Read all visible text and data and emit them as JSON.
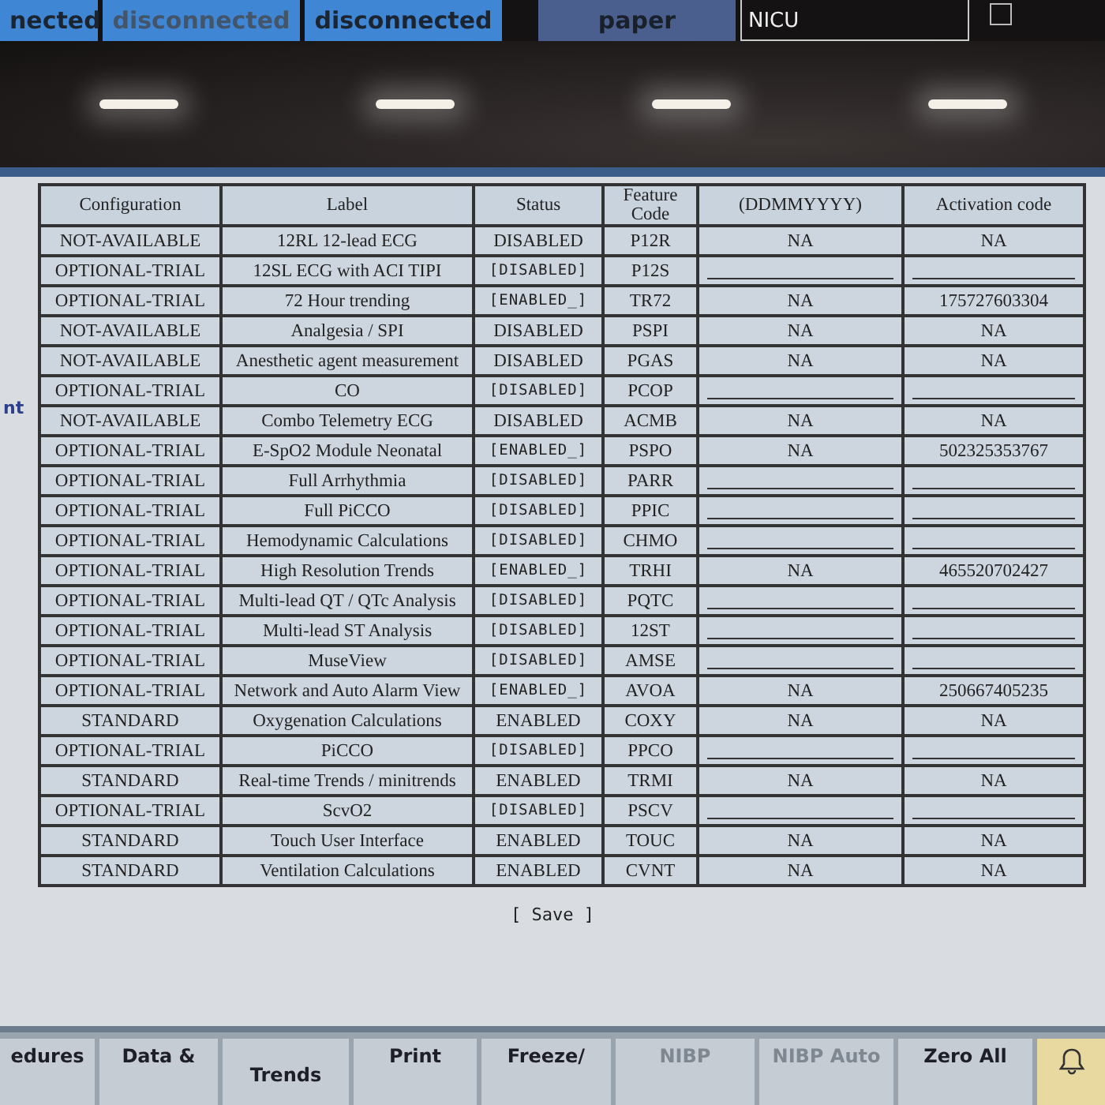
{
  "top_bar": {
    "buttons": [
      {
        "label": "nected",
        "dim": false
      },
      {
        "label": "disconnected",
        "dim": true
      },
      {
        "label": "disconnected",
        "dim": false
      }
    ],
    "paper_button": "paper",
    "location": "NICU",
    "checkbox": {
      "checked": false
    }
  },
  "side_text": "nt",
  "table": {
    "columns": [
      "Configuration",
      "Label",
      "Status",
      "Feature Code",
      "(DDMMYYYY)",
      "Activation code"
    ],
    "rows": [
      {
        "configuration": "NOT-AVAILABLE",
        "label": "12RL 12-lead ECG",
        "status": "DISABLED",
        "editable": false,
        "code": "P12R",
        "expiration": "NA",
        "activation": "NA"
      },
      {
        "configuration": "OPTIONAL-TRIAL",
        "label": "12SL ECG with ACI TIPI",
        "status": "[DISABLED]",
        "editable": true,
        "code": "P12S"
      },
      {
        "configuration": "OPTIONAL-TRIAL",
        "label": "72 Hour trending",
        "status": "[ENABLED_]",
        "editable": true,
        "code": "TR72",
        "expiration": "NA",
        "activation": "175727603304"
      },
      {
        "configuration": "NOT-AVAILABLE",
        "label": "Analgesia / SPI",
        "status": "DISABLED",
        "editable": false,
        "code": "PSPI",
        "expiration": "NA",
        "activation": "NA"
      },
      {
        "configuration": "NOT-AVAILABLE",
        "label": "Anesthetic agent measurement",
        "status": "DISABLED",
        "editable": false,
        "code": "PGAS",
        "expiration": "NA",
        "activation": "NA"
      },
      {
        "configuration": "OPTIONAL-TRIAL",
        "label": "CO",
        "status": "[DISABLED]",
        "editable": true,
        "code": "PCOP"
      },
      {
        "configuration": "NOT-AVAILABLE",
        "label": "Combo Telemetry ECG",
        "status": "DISABLED",
        "editable": false,
        "code": "ACMB",
        "expiration": "NA",
        "activation": "NA"
      },
      {
        "configuration": "OPTIONAL-TRIAL",
        "label": "E-SpO2 Module Neonatal",
        "status": "[ENABLED_]",
        "editable": true,
        "code": "PSPO",
        "expiration": "NA",
        "activation": "502325353767"
      },
      {
        "configuration": "OPTIONAL-TRIAL",
        "label": "Full Arrhythmia",
        "status": "[DISABLED]",
        "editable": true,
        "code": "PARR"
      },
      {
        "configuration": "OPTIONAL-TRIAL",
        "label": "Full PiCCO",
        "status": "[DISABLED]",
        "editable": true,
        "code": "PPIC"
      },
      {
        "configuration": "OPTIONAL-TRIAL",
        "label": "Hemodynamic Calculations",
        "status": "[DISABLED]",
        "editable": true,
        "code": "CHMO"
      },
      {
        "configuration": "OPTIONAL-TRIAL",
        "label": "High Resolution Trends",
        "status": "[ENABLED_]",
        "editable": true,
        "code": "TRHI",
        "expiration": "NA",
        "activation": "465520702427"
      },
      {
        "configuration": "OPTIONAL-TRIAL",
        "label": "Multi-lead QT / QTc Analysis",
        "status": "[DISABLED]",
        "editable": true,
        "code": "PQTC"
      },
      {
        "configuration": "OPTIONAL-TRIAL",
        "label": "Multi-lead ST Analysis",
        "status": "[DISABLED]",
        "editable": true,
        "code": "12ST"
      },
      {
        "configuration": "OPTIONAL-TRIAL",
        "label": "MuseView",
        "status": "[DISABLED]",
        "editable": true,
        "code": "AMSE"
      },
      {
        "configuration": "OPTIONAL-TRIAL",
        "label": "Network and Auto Alarm View",
        "status": "[ENABLED_]",
        "editable": true,
        "code": "AVOA",
        "expiration": "NA",
        "activation": "250667405235"
      },
      {
        "configuration": "STANDARD",
        "label": "Oxygenation Calculations",
        "status": "ENABLED",
        "editable": false,
        "code": "COXY",
        "expiration": "NA",
        "activation": "NA"
      },
      {
        "configuration": "OPTIONAL-TRIAL",
        "label": "PiCCO",
        "status": "[DISABLED]",
        "editable": true,
        "code": "PPCO"
      },
      {
        "configuration": "STANDARD",
        "label": "Real-time Trends / minitrends",
        "status": "ENABLED",
        "editable": false,
        "code": "TRMI",
        "expiration": "NA",
        "activation": "NA"
      },
      {
        "configuration": "OPTIONAL-TRIAL",
        "label": "ScvO2",
        "status": "[DISABLED]",
        "editable": true,
        "code": "PSCV"
      },
      {
        "configuration": "STANDARD",
        "label": "Touch User Interface",
        "status": "ENABLED",
        "editable": false,
        "code": "TOUC",
        "expiration": "NA",
        "activation": "NA"
      },
      {
        "configuration": "STANDARD",
        "label": "Ventilation Calculations",
        "status": "ENABLED",
        "editable": false,
        "code": "CVNT",
        "expiration": "NA",
        "activation": "NA"
      }
    ]
  },
  "save_button": "[ Save ]",
  "bottom_bar": [
    {
      "label": "edures",
      "disabled": false
    },
    {
      "label": "Data &",
      "disabled": false
    },
    {
      "label": "Trends",
      "disabled": false
    },
    {
      "label": "Print",
      "disabled": false
    },
    {
      "label": "Freeze/",
      "disabled": false
    },
    {
      "label": "NIBP",
      "disabled": true
    },
    {
      "label": "NIBP Auto",
      "disabled": true
    },
    {
      "label": "Zero All",
      "disabled": false
    }
  ]
}
